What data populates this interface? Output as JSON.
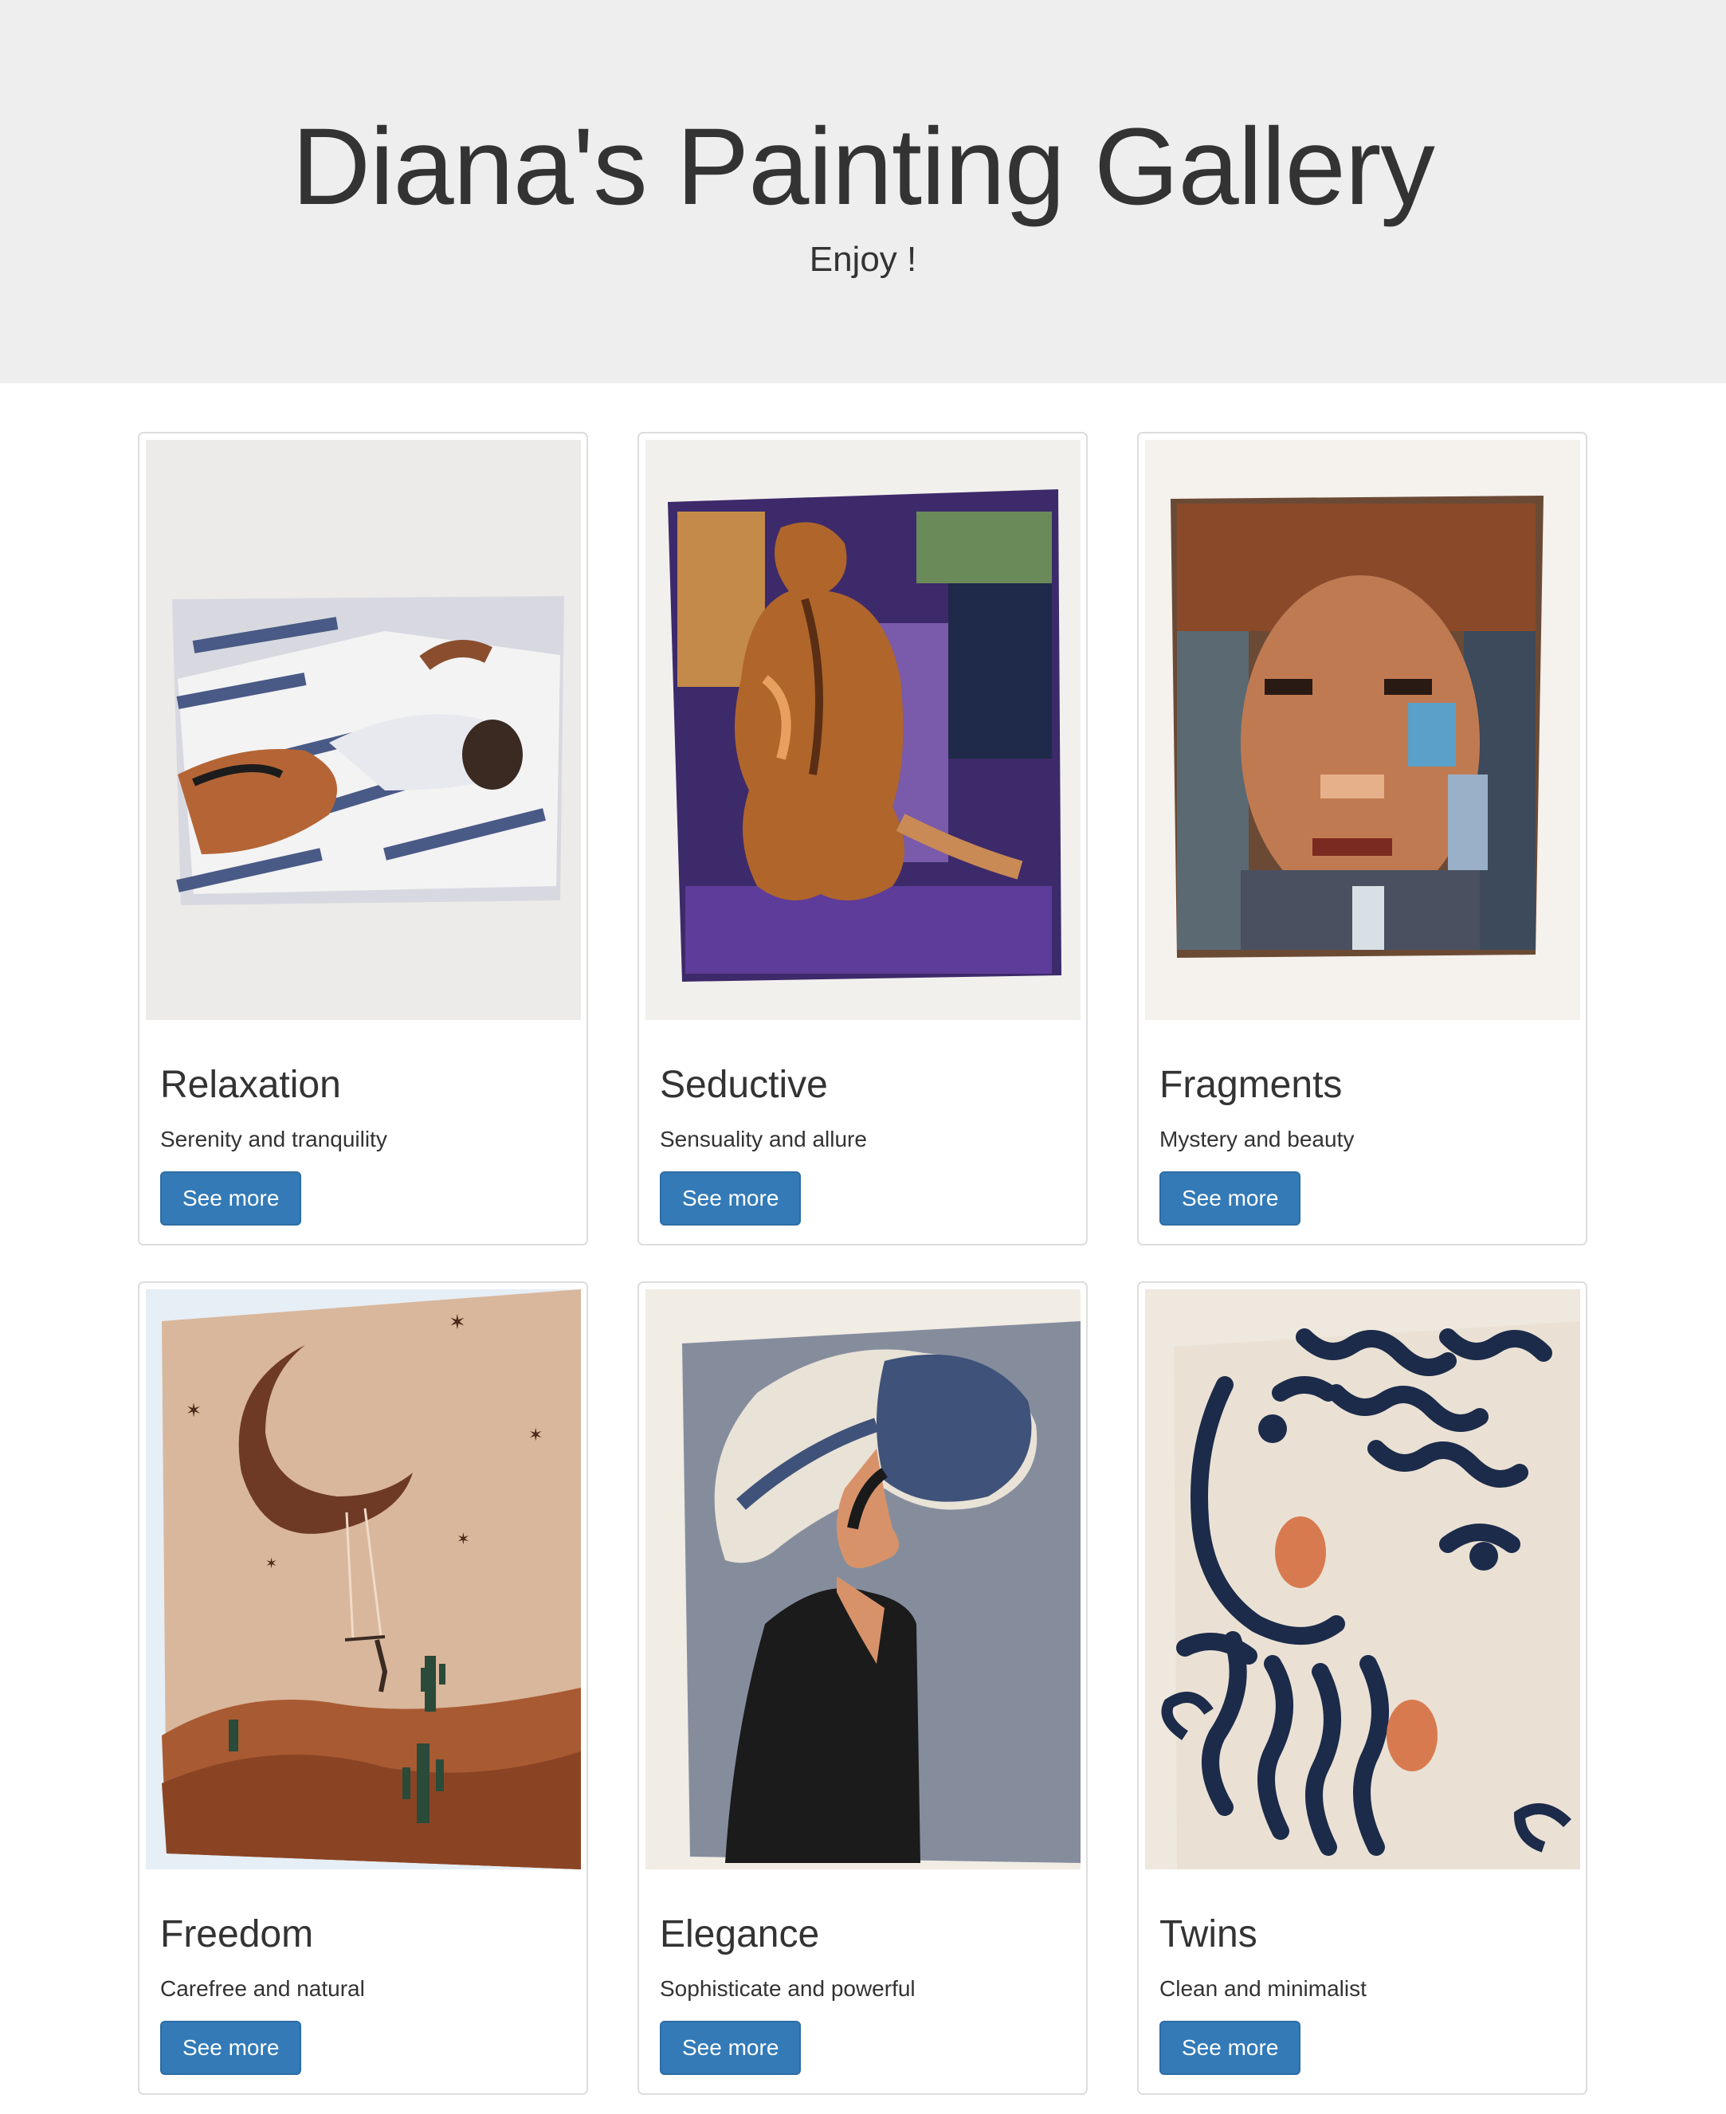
{
  "header": {
    "title": "Diana's Painting Gallery",
    "tagline": "Enjoy !"
  },
  "paintings": [
    {
      "title": "Relaxation",
      "description": "Serenity and tranquility",
      "button_label": "See more",
      "image_icon": "painting-relaxation"
    },
    {
      "title": "Seductive",
      "description": "Sensuality and allure",
      "button_label": "See more",
      "image_icon": "painting-seductive"
    },
    {
      "title": "Fragments",
      "description": "Mystery and beauty",
      "button_label": "See more",
      "image_icon": "painting-fragments"
    },
    {
      "title": "Freedom",
      "description": "Carefree and natural",
      "button_label": "See more",
      "image_icon": "painting-freedom"
    },
    {
      "title": "Elegance",
      "description": "Sophisticate and powerful",
      "button_label": "See more",
      "image_icon": "painting-elegance"
    },
    {
      "title": "Twins",
      "description": "Clean and minimalist",
      "button_label": "See more",
      "image_icon": "painting-twins"
    }
  ],
  "colors": {
    "header_bg": "#eeeeee",
    "button_bg": "#337ab7",
    "text": "#333333",
    "card_border": "#dddddd"
  }
}
